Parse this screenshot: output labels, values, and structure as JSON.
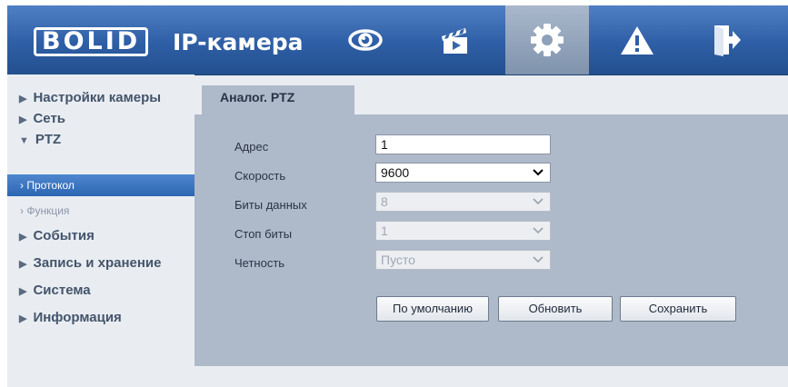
{
  "header": {
    "logo_text": "BOLID",
    "brand_text": "IP-камера",
    "nav": [
      {
        "icon": "eye-icon"
      },
      {
        "icon": "clapperboard-icon"
      },
      {
        "icon": "gear-icon",
        "active": true
      },
      {
        "icon": "warning-icon"
      },
      {
        "icon": "logout-icon"
      }
    ]
  },
  "sidebar": {
    "items": [
      {
        "label": "Настройки камеры",
        "expanded": false
      },
      {
        "label": "Сеть",
        "expanded": false
      },
      {
        "label": "PTZ",
        "expanded": true
      },
      {
        "label": "События",
        "expanded": false
      },
      {
        "label": "Запись и хранение",
        "expanded": false
      },
      {
        "label": "Система",
        "expanded": false
      },
      {
        "label": "Информация",
        "expanded": false
      }
    ],
    "sub_items": [
      {
        "label": "Протокол",
        "active": true
      },
      {
        "label": "Функция",
        "active": false
      }
    ]
  },
  "tab": {
    "label": "Аналог. PTZ"
  },
  "form": {
    "address": {
      "label": "Адрес",
      "value": "1"
    },
    "speed": {
      "label": "Скорость",
      "value": "9600"
    },
    "data_bits": {
      "label": "Биты данных",
      "value": "8"
    },
    "stop_bits": {
      "label": "Стоп биты",
      "value": "1"
    },
    "parity": {
      "label": "Четность",
      "value": "Пусто"
    }
  },
  "buttons": {
    "default": "По умолчанию",
    "refresh": "Обновить",
    "save": "Сохранить"
  }
}
